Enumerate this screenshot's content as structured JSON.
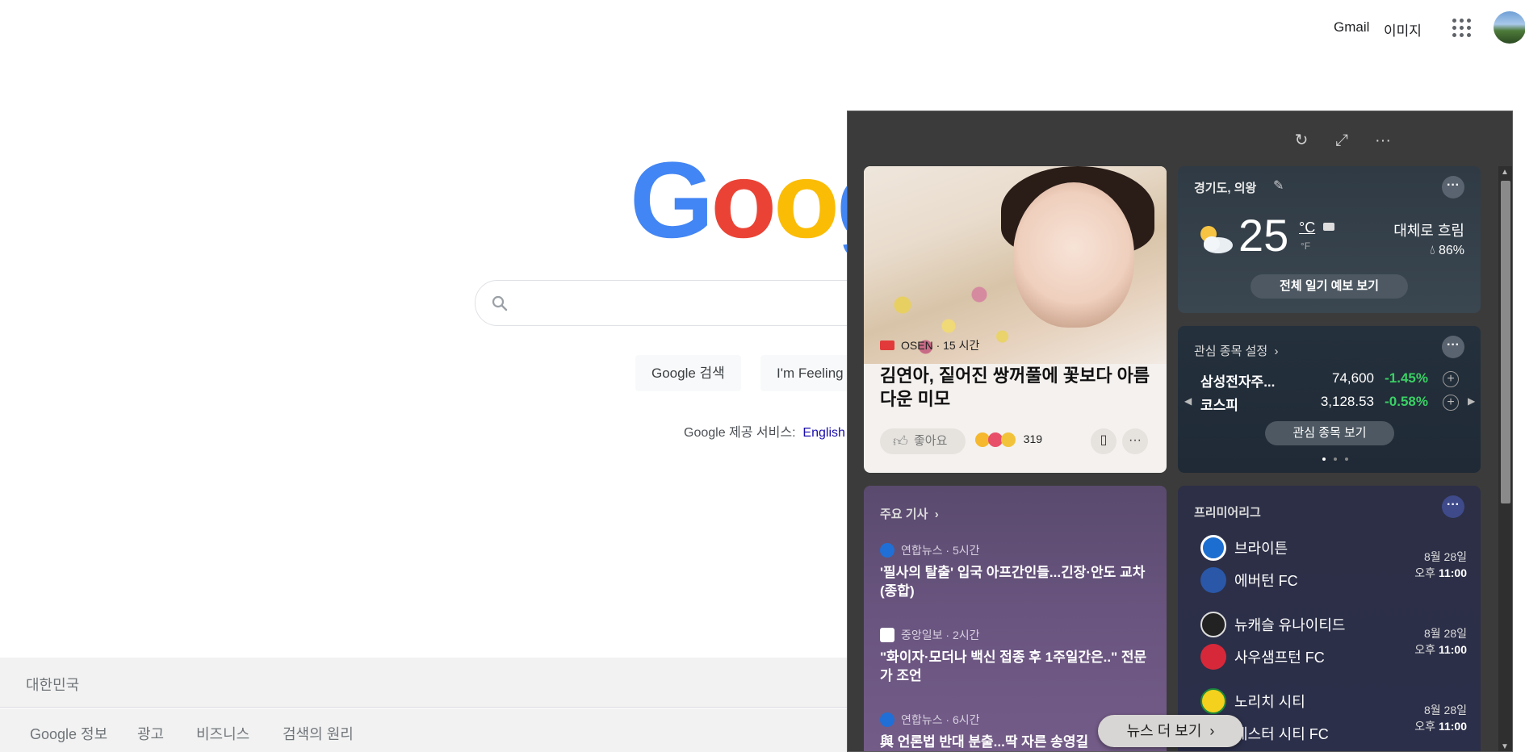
{
  "topbar": {
    "gmail": "Gmail",
    "images": "이미지"
  },
  "google": {
    "search_button": "Google 검색",
    "lucky_button": "I'm Feeling",
    "lang_prefix": "Google 제공 서비스:",
    "lang_link": "English"
  },
  "footer": {
    "country": "대한민국",
    "links": [
      "Google 정보",
      "광고",
      "비즈니스",
      "검색의 원리"
    ]
  },
  "panel": {
    "controls": {
      "refresh": "↻",
      "expand": "⤢",
      "more": "···"
    },
    "hero": {
      "source": "OSEN · 15 시간",
      "title": "김연아, 짙어진 쌍꺼풀에 꽃보다 아름다운 미모",
      "like_label": "좋아요",
      "reaction_count": "319"
    },
    "weather": {
      "location": "경기도, 의왕",
      "temp": "25",
      "unit_c": "°C",
      "unit_f": "°F",
      "condition": "대체로 흐림",
      "humidity": "86%",
      "forecast_button": "전체 일기 예보 보기"
    },
    "stocks": {
      "header": "관심 종목 설정",
      "rows": [
        {
          "name": "삼성전자주...",
          "price": "74,600",
          "change": "-1.45%"
        },
        {
          "name": "코스피",
          "price": "3,128.53",
          "change": "-0.58%"
        }
      ],
      "view_button": "관심 종목 보기"
    },
    "stories": {
      "header": "주요 기사",
      "items": [
        {
          "source": "연합뉴스 · 5시간",
          "title": "'필사의 탈출' 입국 아프간인들...긴장·안도 교차(종합)"
        },
        {
          "source": "중앙일보 · 2시간",
          "title": "\"화이자·모더나 백신 접종 후 1주일간은..\" 전문가 조언"
        },
        {
          "source": "연합뉴스 · 6시간",
          "title": "與 언론법 반대 분출...딱 자른 송영길"
        }
      ]
    },
    "league": {
      "header": "프리미어리그",
      "matches": [
        {
          "home": "브라이튼",
          "away": "에버턴 FC",
          "date": "8월 28일",
          "time_prefix": "오후",
          "time": "11:00"
        },
        {
          "home": "뉴캐슬 유나이티드",
          "away": "사우샘프턴 FC",
          "date": "8월 28일",
          "time_prefix": "오후",
          "time": "11:00"
        },
        {
          "home": "노리치 시티",
          "away": "레스터 시티 FC",
          "date": "8월 28일",
          "time_prefix": "오후",
          "time": "11:00"
        }
      ]
    },
    "more_news": "뉴스 더 보기"
  }
}
